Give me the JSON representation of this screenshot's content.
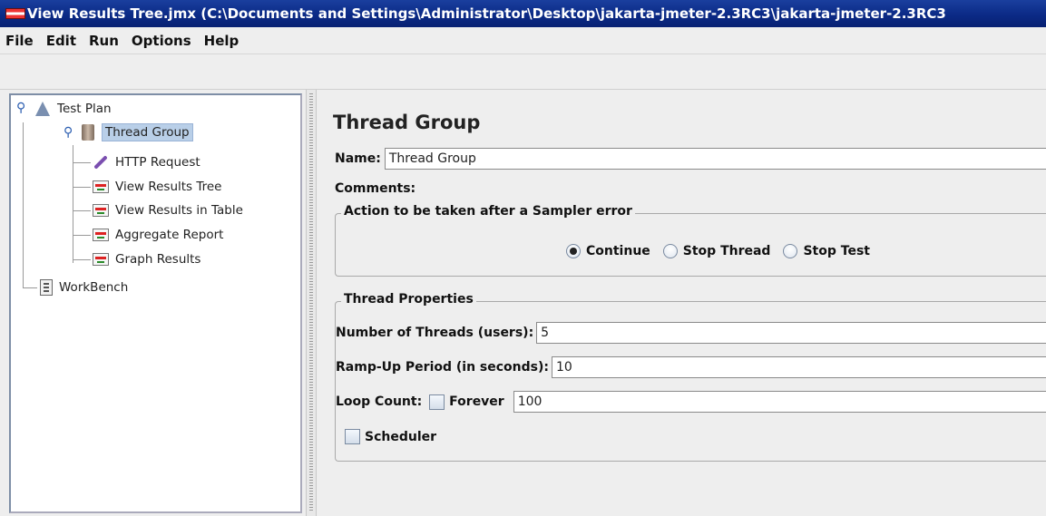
{
  "window": {
    "title": "View Results Tree.jmx (C:\\Documents and Settings\\Administrator\\Desktop\\jakarta-jmeter-2.3RC3\\jakarta-jmeter-2.3RC3"
  },
  "menu": [
    "File",
    "Edit",
    "Run",
    "Options",
    "Help"
  ],
  "tree": {
    "test_plan": "Test Plan",
    "thread_group": "Thread Group",
    "http_request": "HTTP Request",
    "view_results_tree": "View Results Tree",
    "view_results_table": "View Results in Table",
    "aggregate_report": "Aggregate Report",
    "graph_results": "Graph Results",
    "workbench": "WorkBench"
  },
  "panel": {
    "title": "Thread Group",
    "name_label": "Name:",
    "name_value": "Thread Group",
    "comments_label": "Comments:",
    "error_group_title": "Action to be taken after a Sampler error",
    "error_options": [
      "Continue",
      "Stop Thread",
      "Stop Test"
    ],
    "error_selected": "Continue",
    "props_title": "Thread Properties",
    "threads_label": "Number of Threads (users):",
    "threads_value": "5",
    "rampup_label": "Ramp-Up Period (in seconds):",
    "rampup_value": "10",
    "loop_label": "Loop Count:",
    "forever_label": "Forever",
    "forever_checked": false,
    "loop_value": "100",
    "scheduler_label": "Scheduler",
    "scheduler_checked": false
  },
  "colors": {
    "titlebar": "#0b2a86",
    "selection": "#b9cfe8",
    "panel_bg": "#eeeeee"
  }
}
